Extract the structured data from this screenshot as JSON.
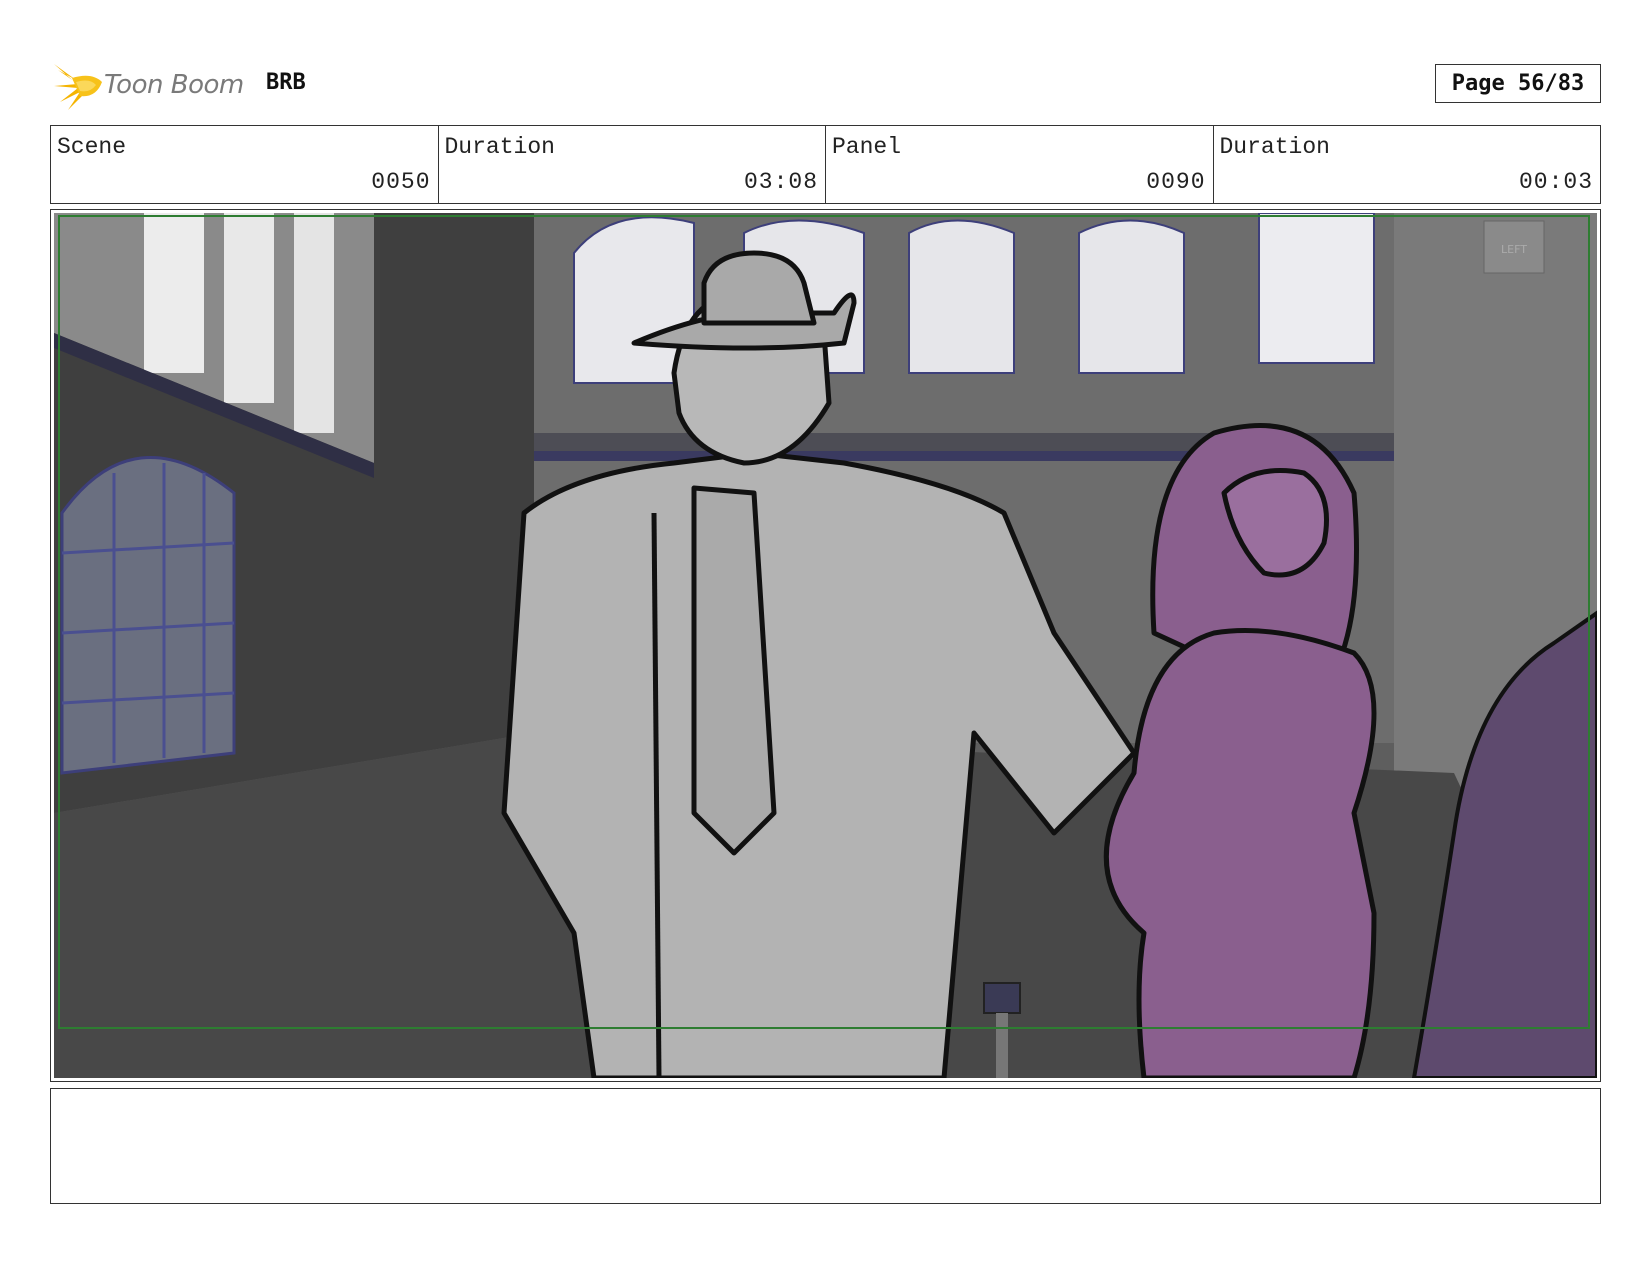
{
  "header": {
    "brand": "Toon Boom",
    "project": "BRB",
    "page": "Page 56/83"
  },
  "info": {
    "scene_label": "Scene",
    "scene_value": "0050",
    "scene_duration_label": "Duration",
    "scene_duration_value": "03:08",
    "panel_label": "Panel",
    "panel_value": "0090",
    "panel_duration_label": "Duration",
    "panel_duration_value": "00:03"
  },
  "panel": {
    "sign_text": "LEFT"
  },
  "notes": "",
  "colors": {
    "logo_yellow": "#f5b400",
    "safe_frame": "#2e7d32",
    "figure_purple": "#8a5f8e",
    "figure_gray": "#b3b3b3"
  }
}
